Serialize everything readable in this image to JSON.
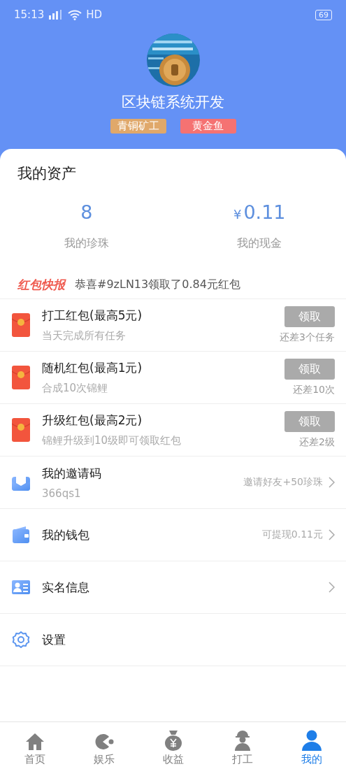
{
  "status_bar": {
    "time": "15:13",
    "network": "HD",
    "battery": "69"
  },
  "profile": {
    "name": "区块链系统开发",
    "badges": [
      {
        "text": "青铜矿工",
        "color": "#e0a86a"
      },
      {
        "text": "黄金鱼",
        "color": "#f57272"
      }
    ]
  },
  "assets": {
    "title": "我的资产",
    "items": [
      {
        "value": "8",
        "label": "我的珍珠"
      },
      {
        "currency": "¥",
        "value": "0.11",
        "label": "我的现金"
      }
    ]
  },
  "news": {
    "tag": "红包快报",
    "message": "恭喜#9zLN13领取了0.84元红包"
  },
  "red_packets": [
    {
      "title": "打工红包(最高5元)",
      "desc": "当天完成所有任务",
      "button": "领取",
      "disabled": true,
      "remaining": "还差3个任务"
    },
    {
      "title": "随机红包(最高1元)",
      "desc": "合成10次锦鲤",
      "button": "领取",
      "disabled": true,
      "remaining": "还差10次"
    },
    {
      "title": "升级红包(最高2元)",
      "desc": "锦鲤升级到10级即可领取红包",
      "button": "领取",
      "disabled": true,
      "remaining": "还差2级"
    }
  ],
  "menu": [
    {
      "kind": "invite",
      "title": "我的邀请码",
      "subtitle": "366qs1",
      "hint": "邀请好友+50珍珠",
      "arrow": true
    },
    {
      "kind": "wallet",
      "title": "我的钱包",
      "hint": "可提现0.11元",
      "arrow": true
    },
    {
      "kind": "idcard",
      "title": "实名信息",
      "arrow": true
    },
    {
      "kind": "settings",
      "title": "设置",
      "arrow": false
    }
  ],
  "tab_bar": [
    {
      "kind": "home",
      "label": "首页",
      "selected": false
    },
    {
      "kind": "game",
      "label": "娱乐",
      "selected": false
    },
    {
      "kind": "income",
      "label": "收益",
      "selected": false
    },
    {
      "kind": "work",
      "label": "打工",
      "selected": false
    },
    {
      "kind": "me",
      "label": "我的",
      "selected": true
    }
  ]
}
